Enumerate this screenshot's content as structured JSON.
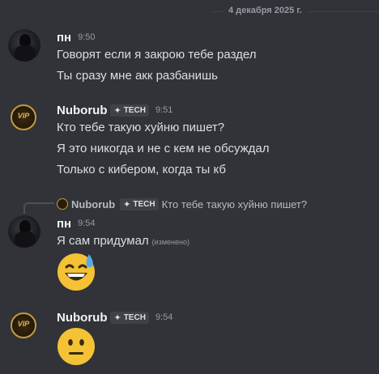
{
  "divider": {
    "date": "4 декабря 2025 г."
  },
  "messages": [
    {
      "author": "пн",
      "time": "9:50",
      "lines": [
        "Говорят если я закрою тебе раздел",
        "Ты сразу мне акк разбанишь"
      ]
    },
    {
      "author": "Nuborub",
      "tag": "TECH",
      "time": "9:51",
      "lines": [
        "Кто тебе такую хуйню пишет?",
        "Я это никогда и не с кем не обсуждал",
        "Только с кибером, когда ты кб"
      ]
    },
    {
      "reply": {
        "author": "Nuborub",
        "tag": "TECH",
        "text": "Кто тебе такую хуйню пишет?"
      },
      "author": "пн",
      "time": "9:54",
      "lines": [
        "Я сам придумал"
      ],
      "edited": "(изменено)",
      "emoji": "grinning-sweat-emoji"
    },
    {
      "author": "Nuborub",
      "tag": "TECH",
      "time": "9:54",
      "emoji": "neutral-face-emoji"
    }
  ],
  "avatar_text": "VIP",
  "colors": {
    "background": "#313338",
    "tag_bg": "#3f4147",
    "gold": "#c79a3b",
    "emoji_yellow": "#f4c234"
  }
}
